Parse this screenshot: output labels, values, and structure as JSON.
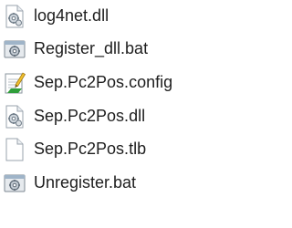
{
  "files": [
    {
      "name": "log4net.dll",
      "icon": "dll-file-icon"
    },
    {
      "name": "Register_dll.bat",
      "icon": "batch-file-icon"
    },
    {
      "name": "Sep.Pc2Pos.config",
      "icon": "config-file-icon"
    },
    {
      "name": "Sep.Pc2Pos.dll",
      "icon": "dll-file-icon"
    },
    {
      "name": "Sep.Pc2Pos.tlb",
      "icon": "blank-file-icon"
    },
    {
      "name": "Unregister.bat",
      "icon": "batch-file-icon"
    }
  ]
}
